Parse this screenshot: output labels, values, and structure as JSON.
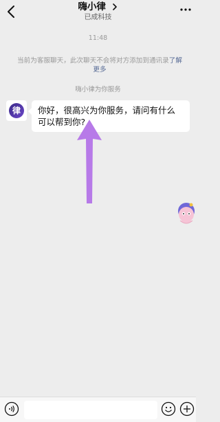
{
  "header": {
    "title": "嗨小律",
    "subtitle": "已成科技"
  },
  "chat": {
    "time": "11:48",
    "notice_text": "当前为客服聊天，此次聊天不会将对方添加到通讯录",
    "notice_link": "了解更多",
    "served_by": "嗨小律为你服务",
    "avatar_char": "律",
    "message": "你好，很高兴为你服务，请问有什么可以帮到你?"
  },
  "input": {
    "value": "",
    "placeholder": ""
  },
  "colors": {
    "background": "#ededed",
    "link": "#576b95",
    "arrow": "#b77ae8",
    "brand_avatar": "#4a34a8"
  },
  "icons": [
    "back-arrow-icon",
    "chevron-right-icon",
    "more-icon",
    "voice-icon",
    "emoji-icon",
    "plus-icon"
  ]
}
